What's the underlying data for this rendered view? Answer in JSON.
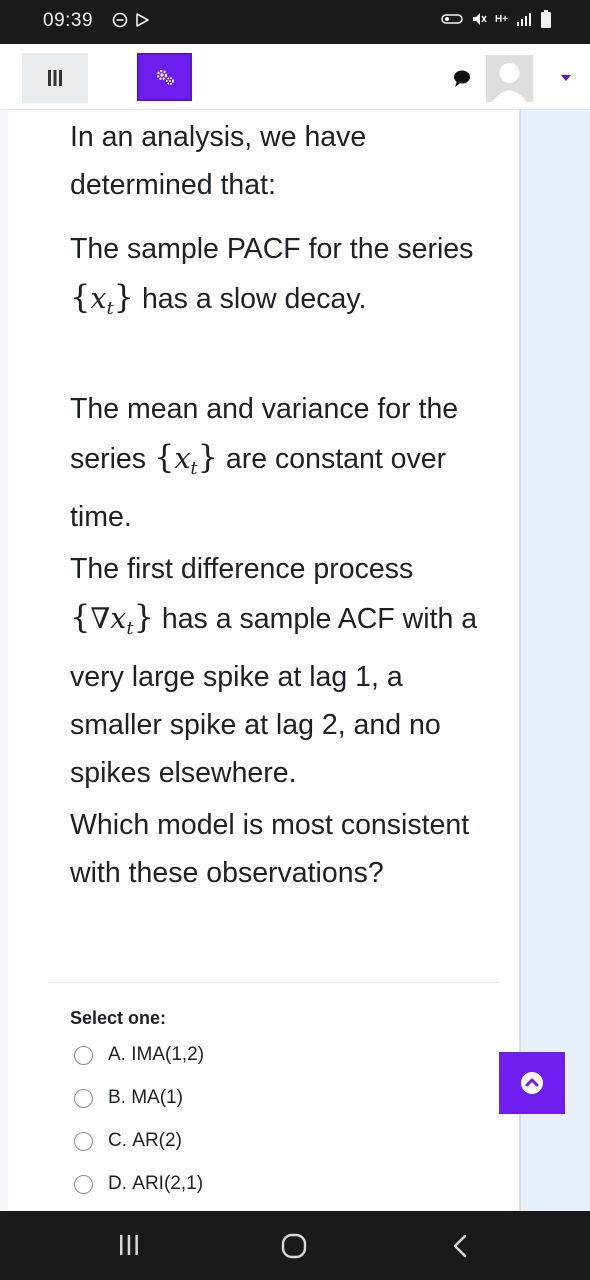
{
  "status_bar": {
    "time": "09:39",
    "network_label": "H+"
  },
  "icons": {
    "menu": "hamburger-icon",
    "settings": "gear-icon",
    "chat": "chat-bubble-icon",
    "avatar": "user-avatar-icon",
    "dropdown": "caret-down-icon",
    "scroll_top": "chevron-up-icon"
  },
  "colors": {
    "accent": "#6f1ef0",
    "status_bar": "#1a1a1a",
    "page_side": "#e8f0fb"
  },
  "question": {
    "intro": "In an analysis, we have determined that:",
    "p1_before": "The sample PACF for the series ",
    "p1_after": " has a slow decay.",
    "p2_before": "The mean and variance for the series ",
    "p2_after": " are constant over time.",
    "p3_after": " has a sample ACF with a very large spike at lag 1, a smaller spike at lag 2, and no spikes elsewhere.",
    "p3_before": "The first difference process ",
    "prompt": "Which model is most consistent with these observations?",
    "math_series": "x",
    "math_sub": "t",
    "math_nabla": "∇"
  },
  "answer": {
    "select_label": "Select one:",
    "options": [
      {
        "letter": "A.",
        "text": "IMA(1,2)"
      },
      {
        "letter": "B.",
        "text": "MA(1)"
      },
      {
        "letter": "C.",
        "text": "AR(2)"
      },
      {
        "letter": "D.",
        "text": "ARI(2,1)"
      }
    ]
  }
}
